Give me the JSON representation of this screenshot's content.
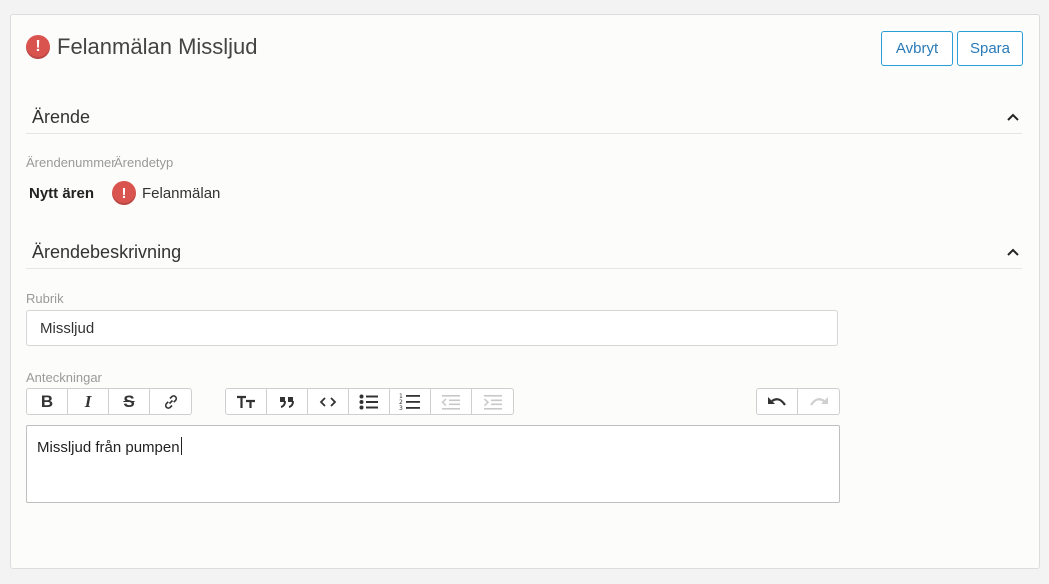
{
  "header": {
    "title": "Felanmälan Missljud",
    "cancel_label": "Avbryt",
    "save_label": "Spara"
  },
  "section_arende": {
    "title": "Ärende",
    "number_label": "Ärendenummer",
    "type_label": "Ärendetyp",
    "number_value": "Nytt ären",
    "type_value": "Felanmälan"
  },
  "section_beskrivning": {
    "title": "Ärendebeskrivning",
    "rubrik_label": "Rubrik",
    "rubrik_value": "Missljud",
    "notes_label": "Anteckningar",
    "notes_value": "Missljud från pumpen"
  },
  "toolbar": {
    "format": [
      "bold-icon",
      "italic-icon",
      "strikethrough-icon",
      "link-icon"
    ],
    "blocks": [
      "heading-icon",
      "quote-icon",
      "code-icon",
      "bullet-list-icon",
      "numbered-list-icon",
      "outdent-icon",
      "indent-icon"
    ],
    "history": [
      "undo-icon",
      "redo-icon"
    ]
  },
  "colors": {
    "accent": "#2a9fd6",
    "alert": "#d9534f"
  }
}
